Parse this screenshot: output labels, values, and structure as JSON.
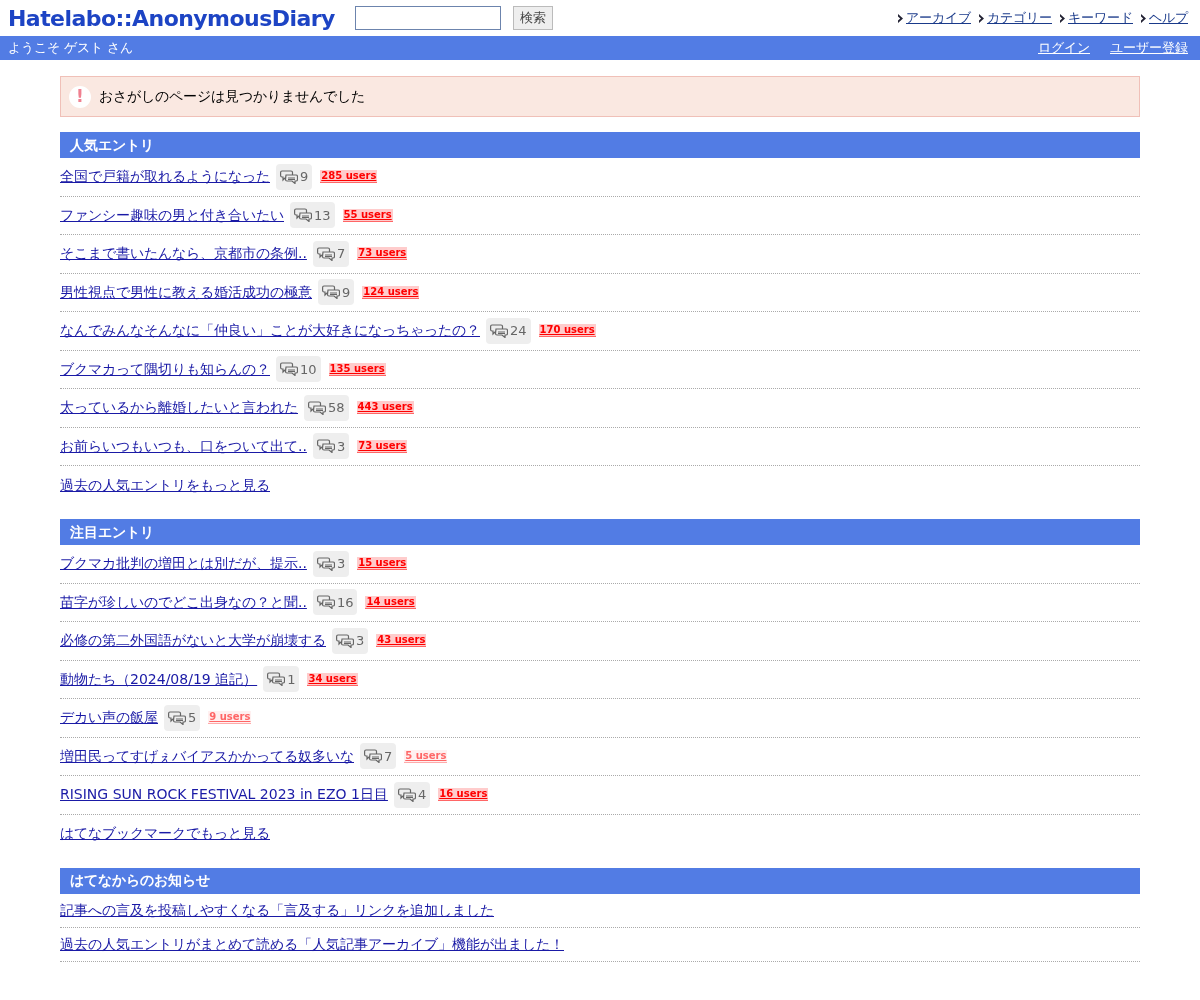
{
  "header": {
    "logo": "Hatelabo::AnonymousDiary",
    "search_button": "検索",
    "nav": [
      "アーカイブ",
      "カテゴリー",
      "キーワード",
      "ヘルプ"
    ]
  },
  "user_bar": {
    "greeting": "ようこそ ゲスト さん",
    "links": [
      "ログイン",
      "ユーザー登録"
    ]
  },
  "alert": {
    "icon": "!",
    "message": "おさがしのページは見つかりませんでした"
  },
  "sections": [
    {
      "title": "人気エントリ",
      "entries": [
        {
          "title": "全国で戸籍が取れるようになった",
          "comments": "9",
          "bookmarks": "285 users",
          "kind": "hot"
        },
        {
          "title": "ファンシー趣味の男と付き合いたい",
          "comments": "13",
          "bookmarks": "55 users",
          "kind": "hot"
        },
        {
          "title": "そこまで書いたんなら、京都市の条例..",
          "comments": "7",
          "bookmarks": "73 users",
          "kind": "hot"
        },
        {
          "title": "男性視点で男性に教える婚活成功の極意",
          "comments": "9",
          "bookmarks": "124 users",
          "kind": "hot"
        },
        {
          "title": "なんでみんなそんなに「仲良い」ことが大好きになっちゃったの？",
          "comments": "24",
          "bookmarks": "170 users",
          "kind": "hot"
        },
        {
          "title": "ブクマカって隅切りも知らんの？",
          "comments": "10",
          "bookmarks": "135 users",
          "kind": "hot"
        },
        {
          "title": "太っているから離婚したいと言われた",
          "comments": "58",
          "bookmarks": "443 users",
          "kind": "hot"
        },
        {
          "title": "お前らいつもいつも、口をついて出て..",
          "comments": "3",
          "bookmarks": "73 users",
          "kind": "hot"
        }
      ],
      "more": "過去の人気エントリをもっと見る"
    },
    {
      "title": "注目エントリ",
      "entries": [
        {
          "title": "ブクマカ批判の増田とは別だが、提示..",
          "comments": "3",
          "bookmarks": "15 users",
          "kind": "hot"
        },
        {
          "title": "苗字が珍しいのでどこ出身なの？と聞..",
          "comments": "16",
          "bookmarks": "14 users",
          "kind": "hot"
        },
        {
          "title": "必修の第二外国語がないと大学が崩壊する",
          "comments": "3",
          "bookmarks": "43 users",
          "kind": "hot"
        },
        {
          "title": "動物たち（2024/08/19 追記）",
          "comments": "1",
          "bookmarks": "34 users",
          "kind": "hot"
        },
        {
          "title": "デカい声の飯屋",
          "comments": "5",
          "bookmarks": "9 users",
          "kind": "few"
        },
        {
          "title": "増田民ってすげぇバイアスかかってる奴多いな",
          "comments": "7",
          "bookmarks": "5 users",
          "kind": "few"
        },
        {
          "title": "RISING SUN ROCK FESTIVAL 2023 in EZO 1日目",
          "comments": "4",
          "bookmarks": "16 users",
          "kind": "hot"
        }
      ],
      "more": "はてなブックマークでもっと見る"
    },
    {
      "title": "はてなからのお知らせ",
      "entries": [
        {
          "title": "記事への言及を投稿しやすくなる「言及する」リンクを追加しました"
        },
        {
          "title": "過去の人気エントリがまとめて読める「人気記事アーカイブ」機能が出ました！"
        }
      ]
    }
  ]
}
